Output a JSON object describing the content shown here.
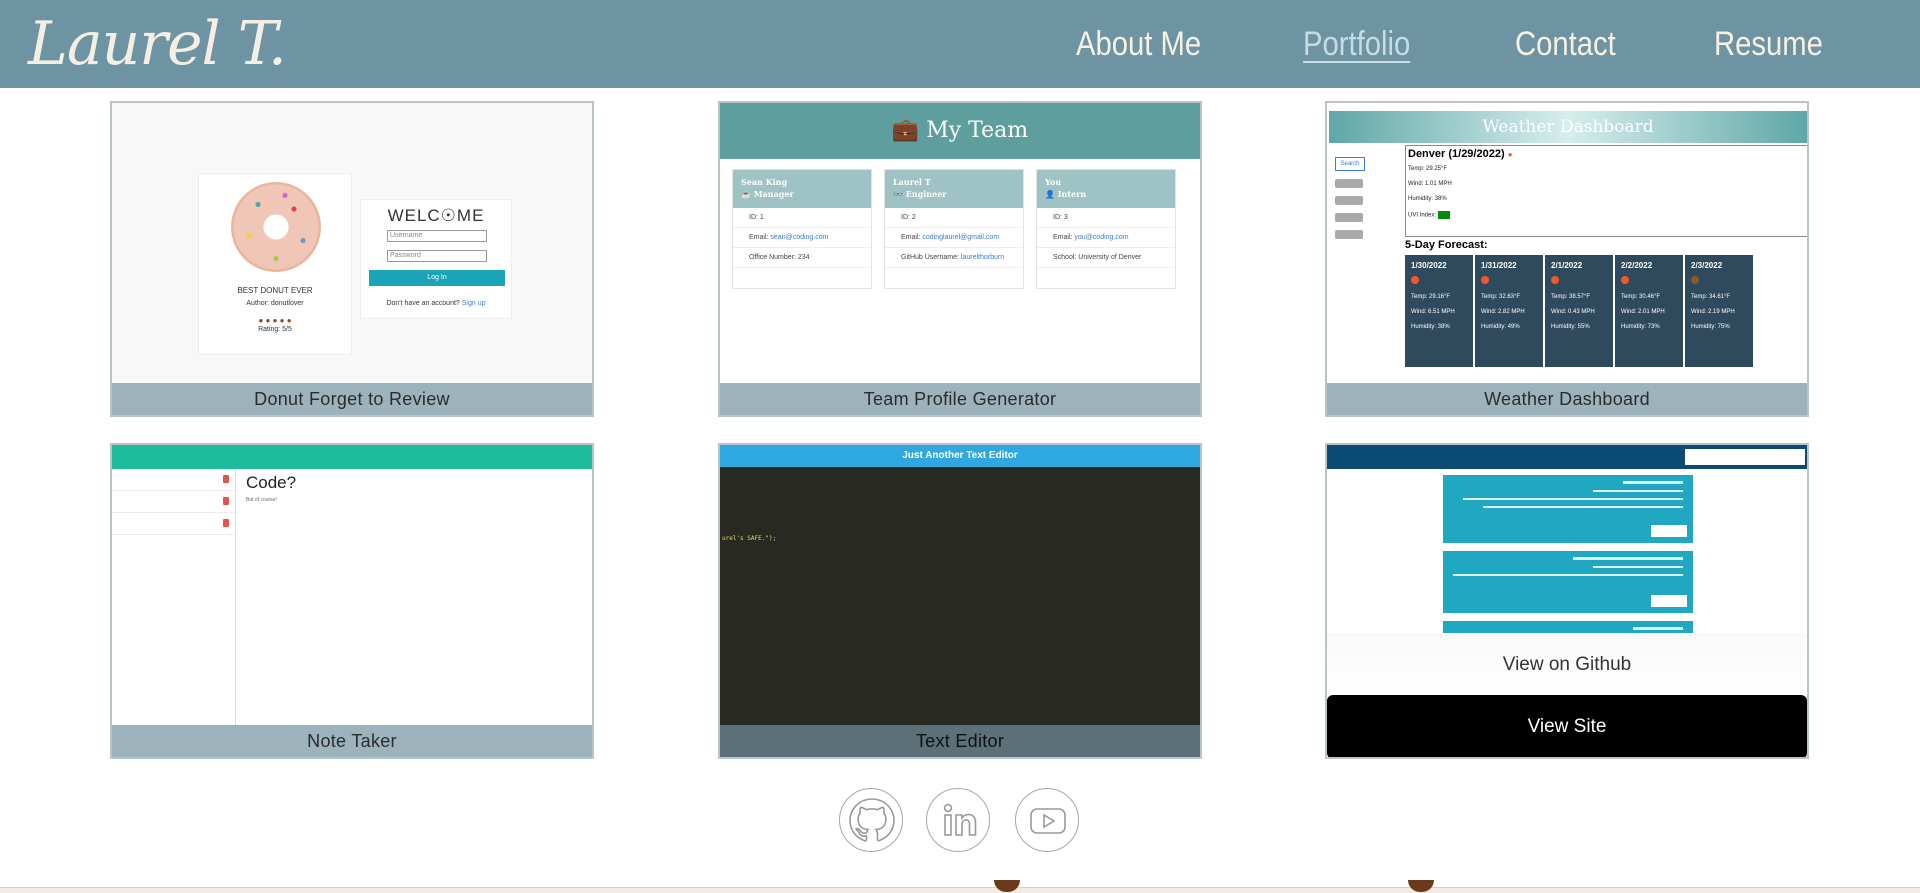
{
  "header": {
    "logo": "Laurel T.",
    "nav": [
      {
        "label": "About Me"
      },
      {
        "label": "Portfolio"
      },
      {
        "label": "Contact"
      },
      {
        "label": "Resume"
      }
    ]
  },
  "projects": [
    {
      "caption": "Donut Forget to Review",
      "preview": {
        "product": "BEST DONUT EVER",
        "author": "Author: donutlover",
        "rating": "Rating: 5/5",
        "welcome": "WELC☉ME",
        "username_ph": "Username",
        "password_ph": "Password",
        "login": "Log In",
        "signup_text": "Don't have an account?",
        "signup_link": "Sign up"
      }
    },
    {
      "caption": "Team Profile Generator",
      "preview": {
        "title": "My Team",
        "members": [
          {
            "name": "Sean King",
            "role": "Manager",
            "id": "ID: 1",
            "email_label": "Email:",
            "email": "sean@coding.com",
            "extra": "Office Number: 234",
            "extra_link": ""
          },
          {
            "name": "Laurel T",
            "role": "Engineer",
            "id": "ID: 2",
            "email_label": "Email:",
            "email": "codinglaurel@gmail.com",
            "extra": "GitHub Username:",
            "extra_link": "laurelthorburn"
          },
          {
            "name": "You",
            "role": "Intern",
            "id": "ID: 3",
            "email_label": "Email:",
            "email": "you@coding.com",
            "extra": "School: University of Denver",
            "extra_link": ""
          }
        ]
      }
    },
    {
      "caption": "Weather Dashboard",
      "preview": {
        "title": "Weather Dashboard",
        "search": "Search",
        "city": "Denver (1/29/2022)",
        "temp": "Temp: 29.25°F",
        "wind": "Wind: 1.01 MPH",
        "humidity": "Humidity: 38%",
        "uvi": "UVI Index:",
        "forecast_title": "5-Day Forecast:",
        "days": [
          {
            "date": "1/30/2022",
            "temp": "Temp: 29.16°F",
            "wind": "Wind: 6.51 MPH",
            "hum": "Humidity: 38%"
          },
          {
            "date": "1/31/2022",
            "temp": "Temp: 32.63°F",
            "wind": "Wind: 2.82 MPH",
            "hum": "Humidity: 49%"
          },
          {
            "date": "2/1/2022",
            "temp": "Temp: 38.57°F",
            "wind": "Wind: 0.43 MPH",
            "hum": "Humidity: 55%"
          },
          {
            "date": "2/2/2022",
            "temp": "Temp: 30.46°F",
            "wind": "Wind: 2.01 MPH",
            "hum": "Humidity: 73%"
          },
          {
            "date": "2/3/2022",
            "temp": "Temp: 34.61°F",
            "wind": "Wind: 2.19 MPH",
            "hum": "Humidity: 75%"
          }
        ]
      }
    },
    {
      "caption": "Note Taker",
      "preview": {
        "title": "Code?",
        "sub": "But of course!"
      }
    },
    {
      "caption": "Text Editor",
      "preview": {
        "title": "Just Another Text Editor",
        "code": "urel's SAFE.\");"
      }
    },
    {
      "caption": "",
      "hover": {
        "github": "View on Github",
        "site": "View Site"
      }
    }
  ],
  "social": [
    {
      "icon": "github-icon"
    },
    {
      "icon": "linkedin-icon"
    },
    {
      "icon": "youtube-icon"
    }
  ],
  "colors": {
    "header": "#6e94a3",
    "caption": "#9cb3bc"
  }
}
